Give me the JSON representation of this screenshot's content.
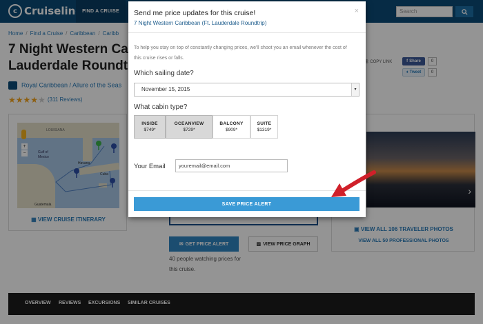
{
  "site": {
    "logo_text": "Cruiseline",
    "nav_find": "FIND A CRUISE",
    "search_placeholder": "Search"
  },
  "breadcrumb": [
    "Home",
    "Find a Cruise",
    "Caribbean",
    "Caribb"
  ],
  "cruise": {
    "title_line1": "7 Night Western Ca",
    "title_line2": "Lauderdale Roundt",
    "line": "Royal Caribbean / Allure of the Seas",
    "stars": 4,
    "reviews": "(311 Reviews)"
  },
  "share": {
    "copy_link": "COPY LINK",
    "fb_label": "Share",
    "fb_count": "0",
    "tw_label": "Tweet",
    "tw_count": "0"
  },
  "map": {
    "labels": [
      "LOUISIANA",
      "Gulf of Mexico",
      "Havana",
      "Cuba",
      "Guatemala",
      "Jamaica"
    ],
    "link": "VIEW CRUISE ITINERARY"
  },
  "photos": {
    "link_traveler": "VIEW ALL 106 TRAVELER PHOTOS",
    "link_pro": "VIEW ALL 50 PROFESSIONAL PHOTOS"
  },
  "actions": {
    "get_price_alert": "GET PRICE ALERT",
    "view_price_graph": "VIEW PRICE GRAPH",
    "watching": "40 people watching prices for this cruise."
  },
  "footer_nav": [
    "OVERVIEW",
    "REVIEWS",
    "EXCURSIONS",
    "SIMILAR CRUISES"
  ],
  "modal": {
    "title": "Send me price updates for this cruise!",
    "subtitle": "7 Night Western Caribbean (Ft. Lauderdale Roundtrip)",
    "close": "×",
    "description": "To help you stay on top of constantly changing prices, we'll shoot you an email whenever the cost of this cruise rises or falls.",
    "sailing_question": "Which sailing date?",
    "sailing_value": "November 15, 2015",
    "cabin_question": "What cabin type?",
    "cabins": [
      {
        "name": "INSIDE",
        "price": "$749*",
        "selected": true
      },
      {
        "name": "OCEANVIEW",
        "price": "$729*",
        "selected": true
      },
      {
        "name": "BALCONY",
        "price": "$909*",
        "selected": false
      },
      {
        "name": "SUITE",
        "price": "$1319*",
        "selected": false
      }
    ],
    "email_label": "Your Email",
    "email_value": "youremail@email.com",
    "save_label": "SAVE PRICE ALERT"
  },
  "colors": {
    "nav": "#0b4a78",
    "accent": "#3a9ad6",
    "arrow": "#d0202a",
    "stars": "#f3a31a"
  }
}
